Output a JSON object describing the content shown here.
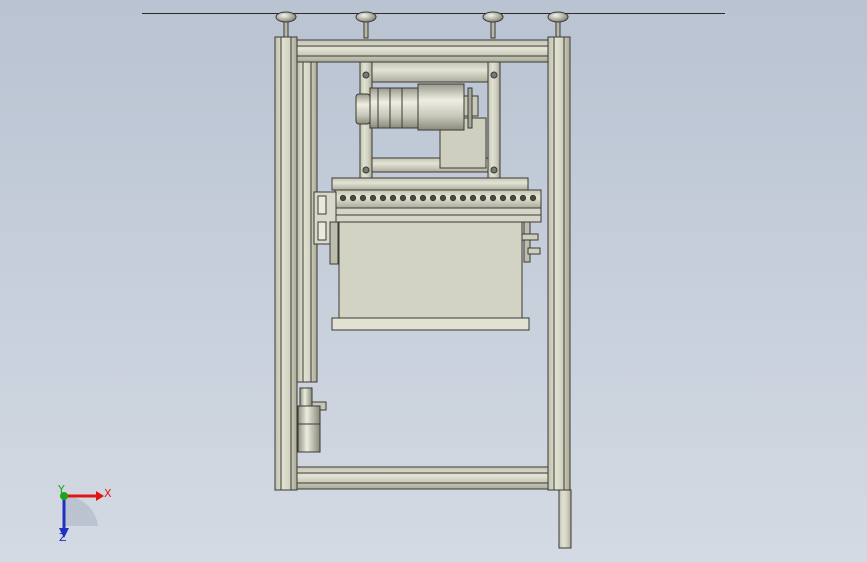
{
  "triad": {
    "x_label": "X",
    "y_label": "Y",
    "z_label": "Z",
    "x_color": "#e01515",
    "y_color": "#1aa51a",
    "z_color": "#2030c0"
  },
  "colors": {
    "frame": "#d3d3c3",
    "frame_edge": "#3a3a34",
    "background_top": "#b9c3d1",
    "background_bottom": "#d4dae3"
  },
  "holes": {
    "count": 20
  }
}
